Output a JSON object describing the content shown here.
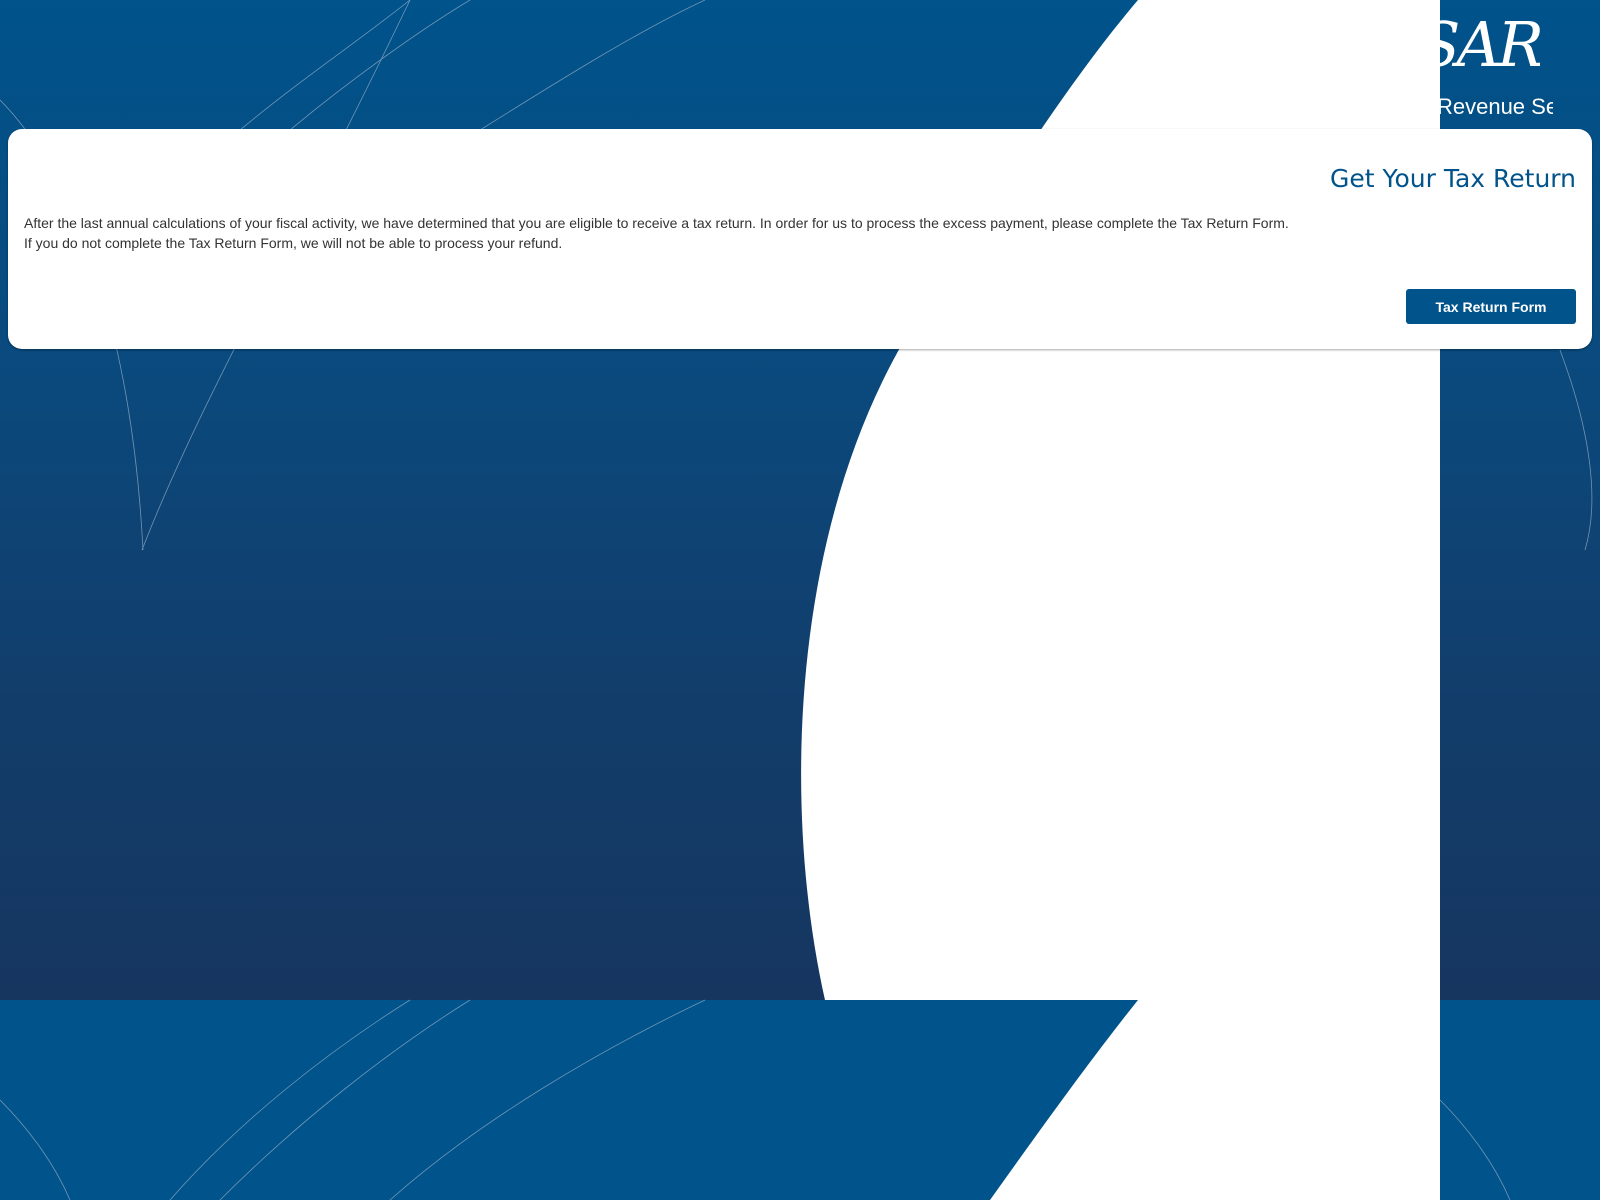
{
  "header": {
    "logo_text": "SARS",
    "agency_name": "South African Revenue Service"
  },
  "card": {
    "title": "Get Your Tax Return",
    "paragraphs": [
      "After the last annual calculations of your fiscal activity, we have determined that you are eligible to receive a tax return. In order for us to process the excess payment, please complete the Tax Return Form.",
      "If you do not complete the Tax Return Form, we will not be able to process your refund."
    ],
    "button_label": "Tax Return Form"
  },
  "colors": {
    "brand_blue": "#00538b",
    "dark_navy": "#163660",
    "text": "#333333",
    "white": "#ffffff"
  }
}
